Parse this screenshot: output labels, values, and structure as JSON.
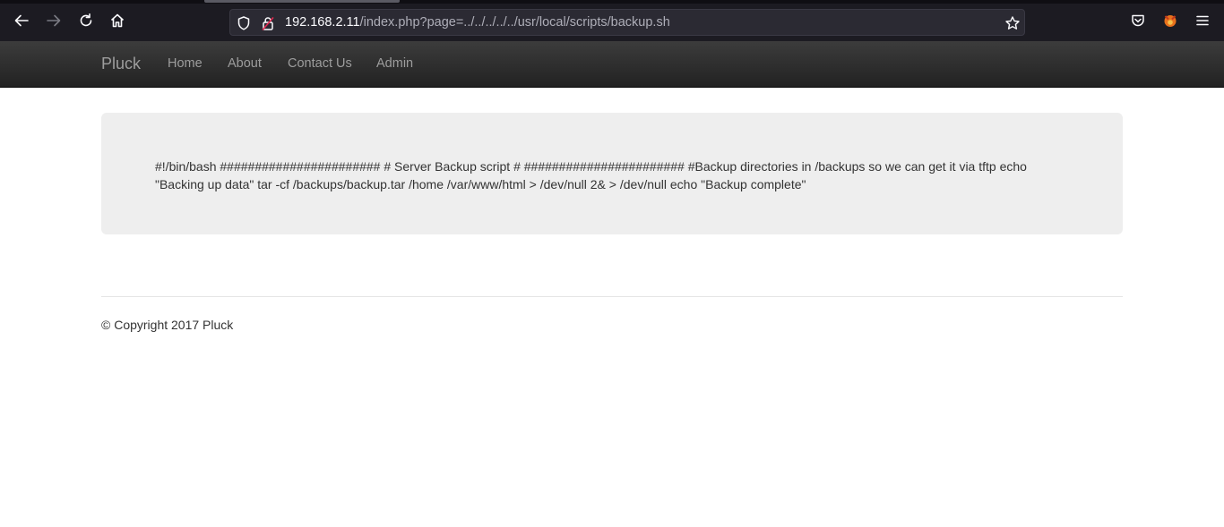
{
  "browser": {
    "url_host": "192.168.2.11",
    "url_path": "/index.php?page=../../../../../usr/local/scripts/backup.sh",
    "icons": {
      "back": "arrow-left-icon",
      "forward": "arrow-right-icon",
      "reload": "reload-icon",
      "home": "home-icon",
      "tracking": "shield-icon",
      "connection": "insecure-lock-icon",
      "bookmark": "star-icon",
      "pocket": "pocket-icon",
      "extension": "fox-extension-icon",
      "menu": "hamburger-menu-icon"
    }
  },
  "site": {
    "brand": "Pluck",
    "nav": [
      "Home",
      "About",
      "Contact Us",
      "Admin"
    ]
  },
  "content": {
    "script_text": "#!/bin/bash ####################### # Server Backup script # ####################### #Backup directories in /backups so we can get it via tftp echo \"Backing up data\" tar -cf /backups/backup.tar /home /var/www/html > /dev/null 2& > /dev/null echo \"Backup complete\""
  },
  "footer": {
    "copyright": "© Copyright 2017 Pluck"
  },
  "colors": {
    "toolbar_bg": "#1c1b22",
    "urlbar_bg": "#2b2a33",
    "navbar_top": "#3c3c3c",
    "navbar_bottom": "#222222",
    "nav_text": "#9d9d9d",
    "jumbotron_bg": "#eeeeee"
  }
}
